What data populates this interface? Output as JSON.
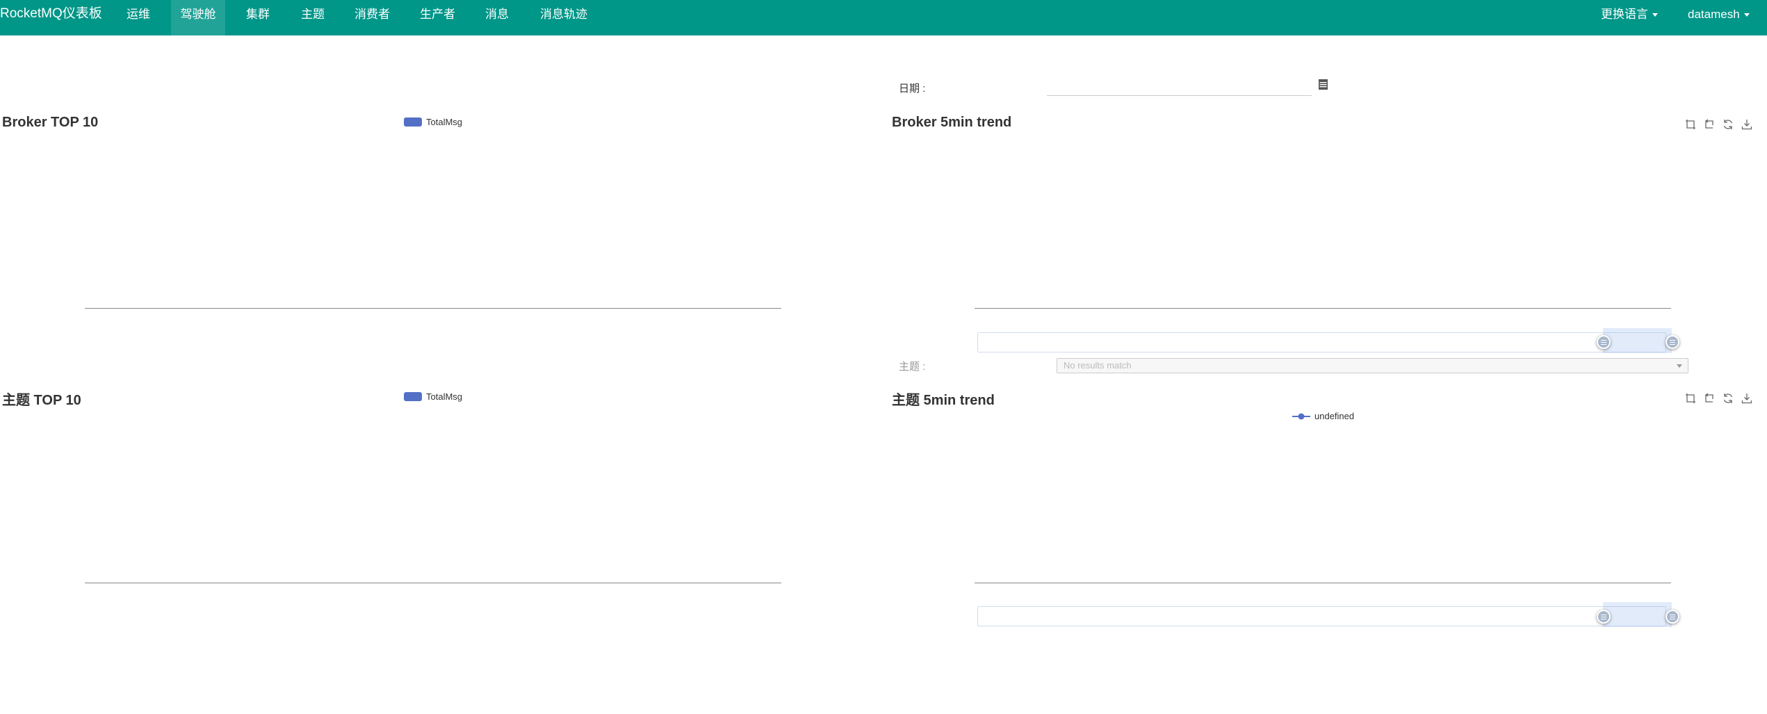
{
  "navbar": {
    "brand": "RocketMQ仪表板",
    "items": [
      "运维",
      "驾驶舱",
      "集群",
      "主题",
      "消费者",
      "生产者",
      "消息",
      "消息轨迹"
    ],
    "active": "驾驶舱",
    "language_menu": "更换语言",
    "user_menu": "datamesh"
  },
  "filters": {
    "date_label": "日期 :",
    "date_value": "",
    "topic_label": "主题 :",
    "topic_select_placeholder": "No results match"
  },
  "panels": {
    "broker_top10": {
      "title": "Broker TOP 10",
      "legend": "TotalMsg"
    },
    "broker_trend": {
      "title": "Broker 5min trend"
    },
    "topic_top10": {
      "title": "主题 TOP 10",
      "legend": "TotalMsg"
    },
    "topic_trend": {
      "title": "主题 5min trend",
      "legend": "undefined"
    }
  },
  "colors": {
    "navbar_bg": "#009688",
    "series": "#5470c6"
  },
  "icons": {
    "toolbox": [
      "zoom-select-icon",
      "zoom-reset-icon",
      "restore-icon",
      "save-image-icon"
    ],
    "date_picker": "calendar-icon"
  }
}
